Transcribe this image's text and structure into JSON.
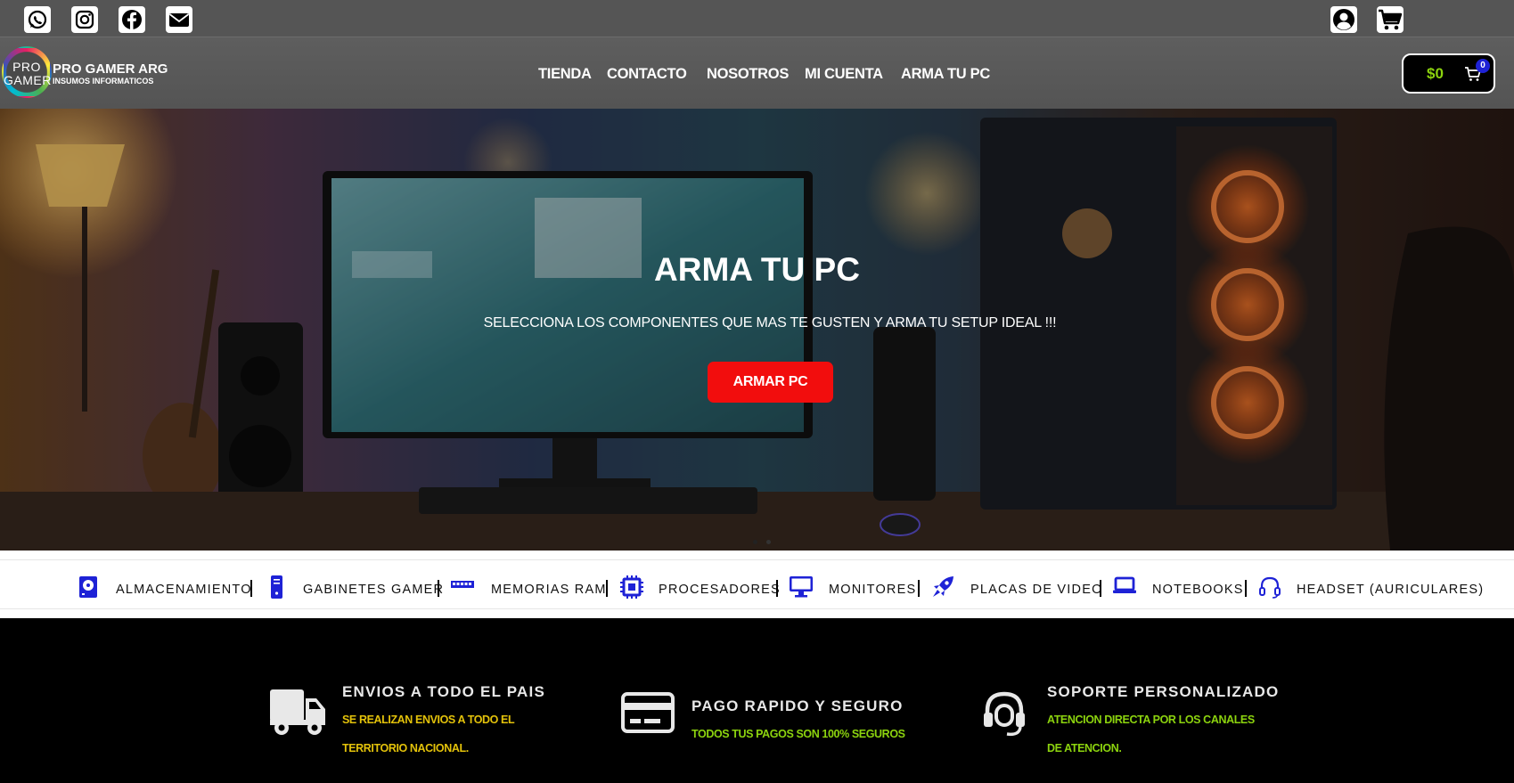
{
  "topbar": {
    "social_icons": [
      "whatsapp-icon",
      "instagram-icon",
      "facebook-icon",
      "envelope-icon"
    ],
    "right_icons": [
      "user-account-icon",
      "cart-icon"
    ]
  },
  "logo": {
    "badge_line1": "PRO",
    "badge_line2": "GAMER",
    "title": "PRO GAMER ARG",
    "subtitle": "INSUMOS INFORMATICOS"
  },
  "nav": {
    "items": [
      "TIENDA",
      "CONTACTO",
      "NOSOTROS",
      "MI CUENTA",
      "ARMA TU PC"
    ]
  },
  "cart": {
    "amount": "$0",
    "count": "0"
  },
  "hero": {
    "title": "ARMA TU PC",
    "subtitle": "SELECCIONA LOS COMPONENTES QUE MAS TE GUSTEN Y ARMA TU SETUP IDEAL !!!",
    "button": "ARMAR PC"
  },
  "categories": [
    {
      "label": "ALMACENAMIENTO",
      "icon": "hard-drive-icon"
    },
    {
      "label": "GABINETES GAMER",
      "icon": "pc-tower-icon"
    },
    {
      "label": "MEMORIAS RAM",
      "icon": "memory-icon"
    },
    {
      "label": "PROCESADORES",
      "icon": "cpu-chip-icon"
    },
    {
      "label": "MONITORES",
      "icon": "monitor-icon"
    },
    {
      "label": "PLACAS DE VIDEO",
      "icon": "rocket-icon"
    },
    {
      "label": "NOTEBOOKS",
      "icon": "laptop-icon"
    },
    {
      "label": "HEADSET (AURICULARES)",
      "icon": "headset-icon"
    }
  ],
  "features": [
    {
      "title": "ENVIOS A TODO EL PAIS",
      "line1": "SE REALIZAN ENVIOS A TODO EL",
      "line2": "TERRITORIO NACIONAL.",
      "icon": "truck-icon"
    },
    {
      "title": "PAGO RAPIDO Y SEGURO",
      "line1": "TODOS TUS PAGOS SON 100% SEGUROS",
      "icon": "credit-card-icon"
    },
    {
      "title": "SOPORTE PERSONALIZADO",
      "line1": "ATENCION DIRECTA POR LOS CANALES",
      "line2": "DE ATENCION.",
      "icon": "headset-support-icon"
    }
  ],
  "colors": {
    "accent_red": "#f20d0d",
    "accent_green": "#8cd30e",
    "accent_yellow": "#e3c20a",
    "category_icon_blue": "#1e22d6"
  }
}
